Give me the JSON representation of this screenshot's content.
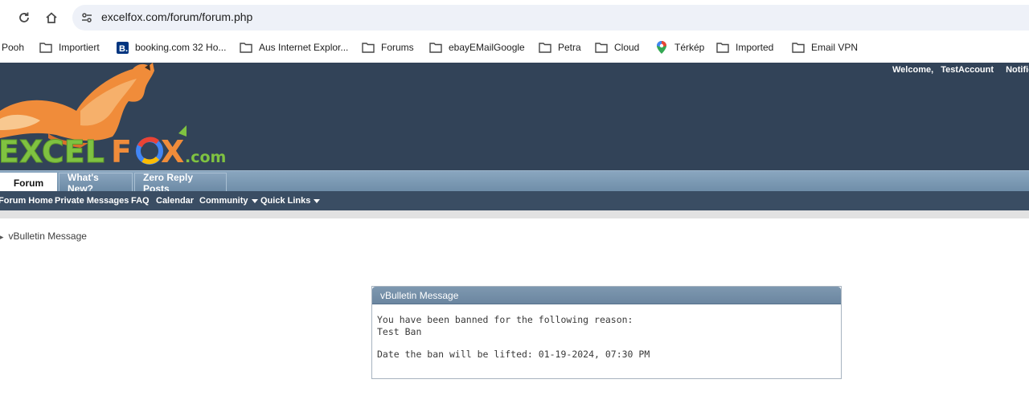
{
  "browser": {
    "url": "excelfox.com/forum/forum.php",
    "bookmarks": [
      {
        "label": "Pooh",
        "icon": "none"
      },
      {
        "label": "Importiert",
        "icon": "folder-icon"
      },
      {
        "label": "booking.com 32 Ho...",
        "icon": "booking-icon"
      },
      {
        "label": "Aus Internet Explor...",
        "icon": "folder-icon"
      },
      {
        "label": "Forums",
        "icon": "folder-icon"
      },
      {
        "label": "ebayEMailGoogle",
        "icon": "folder-icon"
      },
      {
        "label": "Petra",
        "icon": "folder-icon"
      },
      {
        "label": "Cloud",
        "icon": "folder-icon"
      },
      {
        "label": "Térkép",
        "icon": "map-pin-icon"
      },
      {
        "label": "Imported",
        "icon": "folder-icon"
      },
      {
        "label": "Email VPN",
        "icon": "folder-icon"
      }
    ]
  },
  "header": {
    "welcome_label": "Welcome,",
    "username": "TestAccount",
    "notifications_label": "Notifica",
    "logo_text_left": "EXCEL",
    "logo_text_f": "F",
    "logo_text_x": "X",
    "logo_text_domain": ".com"
  },
  "tabs": [
    {
      "label": "Forum",
      "active": true
    },
    {
      "label": "What's New?",
      "active": false
    },
    {
      "label": "Zero Reply Posts",
      "active": false
    }
  ],
  "subnav": [
    {
      "label": "Forum Home",
      "dropdown": false
    },
    {
      "label": "Private Messages",
      "dropdown": false
    },
    {
      "label": "FAQ",
      "dropdown": false
    },
    {
      "label": "Calendar",
      "dropdown": false
    },
    {
      "label": "Community",
      "dropdown": true
    },
    {
      "label": "Quick Links",
      "dropdown": true
    }
  ],
  "breadcrumb": {
    "current": "vBulletin Message"
  },
  "message": {
    "title": "vBulletin Message",
    "line1": "You have been banned for the following reason:",
    "line2": "Test Ban",
    "line3": "Date the ban will be lifted: 01-19-2024, 07:30 PM"
  },
  "colors": {
    "header_bg": "#324358",
    "tab_bg": "#7a98b3",
    "subnav_bg": "#3a4d63"
  }
}
